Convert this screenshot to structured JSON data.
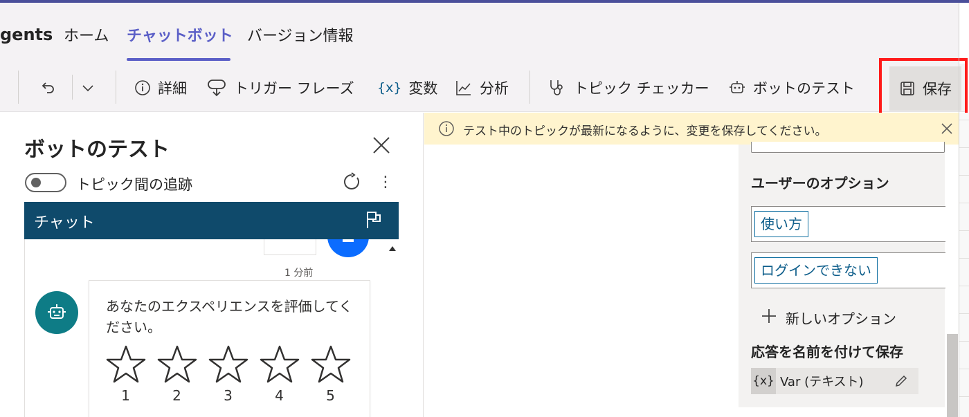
{
  "nav": {
    "brand": "gents",
    "tabs": [
      {
        "label": "ホーム"
      },
      {
        "label": "チャットボット"
      },
      {
        "label": "バージョン情報"
      }
    ]
  },
  "toolbar": {
    "details": "詳細",
    "trigger_phrases": "トリガー フレーズ",
    "variables_icon": "{x}",
    "variables": "変数",
    "analytics": "分析",
    "topic_checker": "トピック チェッカー",
    "test_bot": "ボットのテスト",
    "save": "保存"
  },
  "test_panel": {
    "title": "ボットのテスト",
    "track_label": "トピック間の追跡",
    "track_enabled": false,
    "chat_title": "チャット",
    "timestamp": "1 分前",
    "bot_message": "あなたのエクスペリエンスを評価してください。",
    "rating_labels": [
      "1",
      "2",
      "3",
      "4",
      "5"
    ]
  },
  "banner": {
    "text": "テスト中のトピックが最新になるように、変更を保存してください。"
  },
  "node": {
    "user_options_title": "ユーザーのオプション",
    "options": [
      "使い方",
      "ログインできない"
    ],
    "new_option": "新しいオプション",
    "save_response_title": "応答を名前を付けて保存",
    "var_badge": "{x}",
    "var_text": "Var (テキスト)"
  },
  "colors": {
    "accent": "#5b5fc7",
    "chat_header": "#0f4a6b",
    "bot_avatar": "#0e7c86",
    "user_avatar": "#0b6cff",
    "banner_bg": "#fff4ce",
    "highlight": "#ff1a1a"
  }
}
